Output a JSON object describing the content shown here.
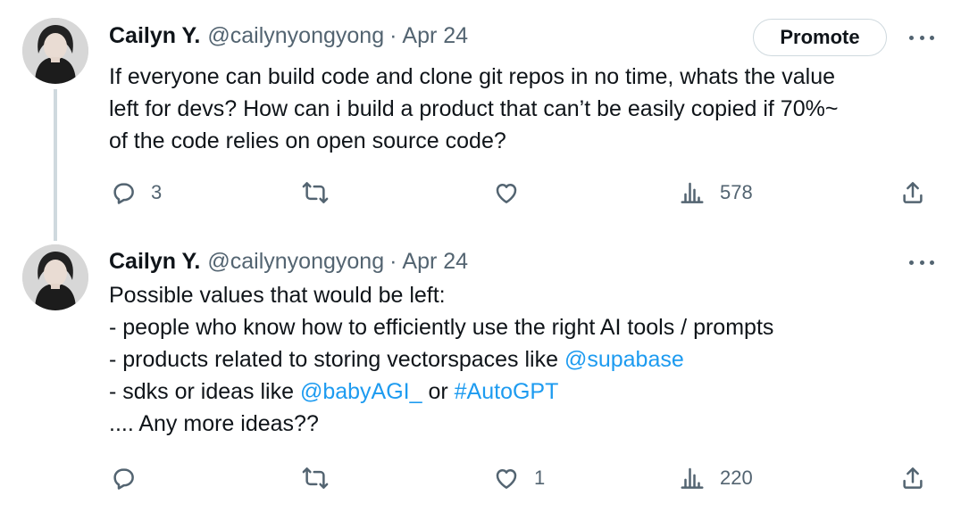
{
  "tweets": [
    {
      "author": {
        "name": "Cailyn Y.",
        "handle": "@cailynyongyong"
      },
      "separator": "·",
      "date": "Apr 24",
      "promote_label": "Promote",
      "body_lines": [
        "If everyone can build code and clone git repos in no time, whats the value",
        "left for devs? How can i build a product that can’t be easily copied if 70%~",
        "of the code relies on open source code?"
      ],
      "replies": "3",
      "likes": "",
      "views": "578"
    },
    {
      "author": {
        "name": "Cailyn Y.",
        "handle": "@cailynyongyong"
      },
      "separator": "·",
      "date": "Apr 24",
      "body": {
        "line1": "Possible values that would be left:",
        "line2": "- people who know how to efficiently use the right AI tools / prompts",
        "line3_text": "- products related to storing vectorspaces like ",
        "line3_mention": "@supabase",
        "line4_text": "- sdks or ideas like ",
        "line4_mention1": "@babyAGI_",
        "line4_middle": " or ",
        "line4_hashtag": "#AutoGPT",
        "line5": ".... Any more ideas??"
      },
      "replies": "",
      "likes": "1",
      "views": "220"
    }
  ],
  "icons": {
    "reply": "reply-icon",
    "retweet": "retweet-icon",
    "like": "heart-icon",
    "views": "views-icon",
    "share": "share-icon",
    "more": "more-icon"
  },
  "colors": {
    "text": "#0f1419",
    "secondary": "#536471",
    "link": "#1d9bf0",
    "border": "#cfd9de"
  }
}
